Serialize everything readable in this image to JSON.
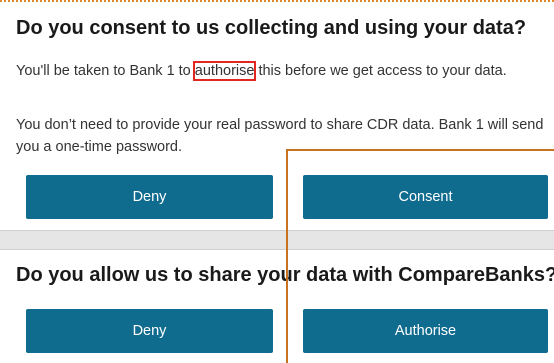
{
  "consent_section": {
    "heading": "Do you consent to us collecting and using your data?",
    "paragraph1_before": "You'll be taken to Bank 1 to ",
    "paragraph1_highlight": "authorise",
    "paragraph1_after": " this before we get access to your data.",
    "paragraph2": "You don’t need to provide your real password to share CDR data. Bank 1 will send you a one-time password.",
    "deny_label": "Deny",
    "consent_label": "Consent"
  },
  "share_section": {
    "heading": "Do you allow us to share your data with CompareBanks?",
    "deny_label": "Deny",
    "authorise_label": "Authorise"
  },
  "colors": {
    "button": "#106c8f",
    "highlight_box": "#e3261f",
    "overlay_line": "#c8731f",
    "top_dots": "#e08a2a"
  }
}
